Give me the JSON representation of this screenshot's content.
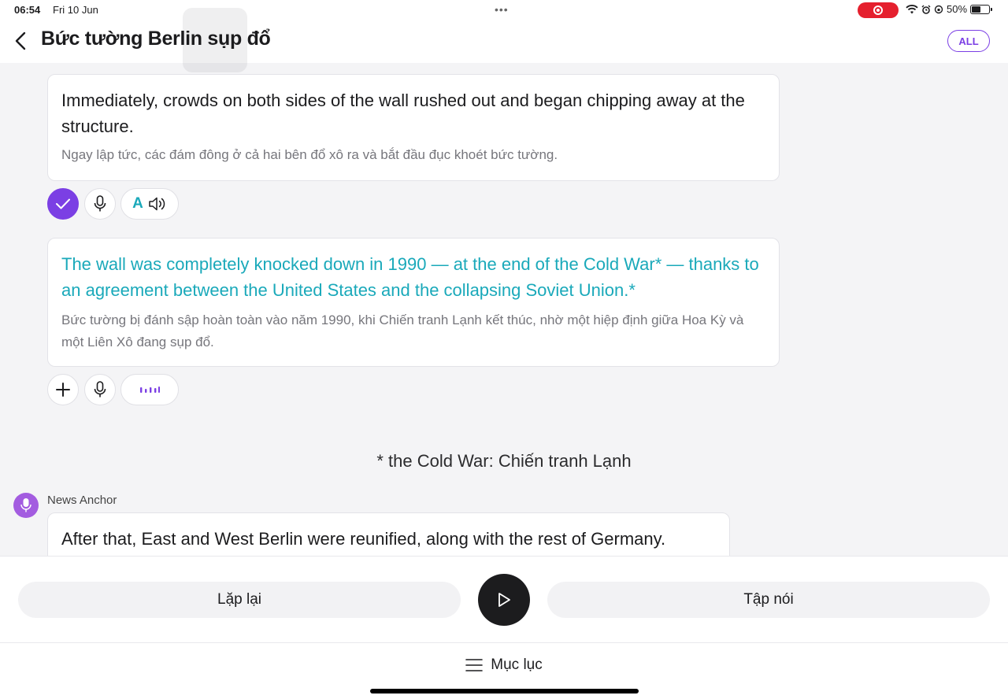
{
  "status_bar": {
    "time": "06:54",
    "date": "Fri 10 Jun",
    "battery": "50%",
    "record_color": "#e5202e"
  },
  "header": {
    "title": "Bức tường Berlin sụp đổ",
    "all_label": "ALL",
    "accent": "#7b3fe4"
  },
  "sentences": [
    {
      "en": "Immediately, crowds on both sides of the wall rushed out and began chipping away at the structure.",
      "vi": "Ngay lập tức, các đám đông ở cả hai bên đổ xô ra và bắt đầu đục khoét bức tường."
    },
    {
      "en": "The wall was completely knocked down in 1990 — at the end of the Cold War* — thanks to an agreement between the United States and the collapsing Soviet Union.*",
      "vi": "Bức tường bị đánh sập hoàn toàn vào năm 1990, khi Chiến tranh Lạnh kết thúc, nhờ một hiệp định giữa Hoa Kỳ và một Liên Xô đang sụp đổ.",
      "highlight_color": "#1aa9ba"
    }
  ],
  "controls": {
    "translate_letter": "A"
  },
  "footnote": "* the Cold War: Chiến tranh Lạnh",
  "speaker": {
    "name": "News Anchor",
    "line": "After that, East and West Berlin were reunified, along with the rest of Germany."
  },
  "bottom": {
    "repeat_label": "Lặp lại",
    "practice_label": "Tập nói",
    "toc_label": "Mục lục"
  }
}
